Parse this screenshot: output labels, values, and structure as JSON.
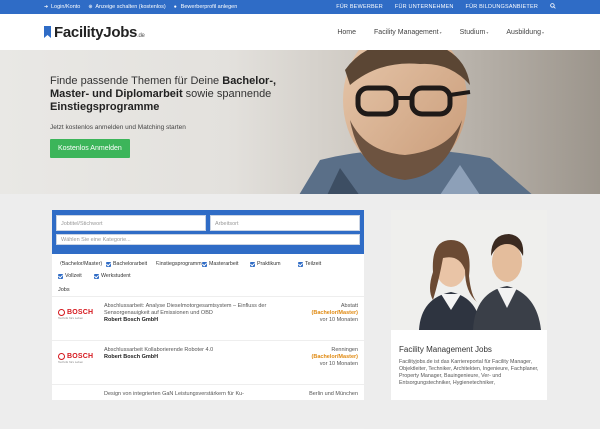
{
  "topbar": {
    "left": [
      {
        "icon": "login-icon",
        "label": "Login/Konto"
      },
      {
        "icon": "plus-icon",
        "label": "Anzeige schalten (kostenlos)"
      },
      {
        "icon": "user-icon",
        "label": "Bewerberprofil anlegen"
      }
    ],
    "right": [
      "FÜR BEWERBER",
      "FÜR UNTERNEHMEN",
      "FÜR BILDUNGSANBIETER"
    ],
    "search_icon": "search-icon"
  },
  "header": {
    "logo_text": "FacilityJobs",
    "logo_suffix": ".de",
    "nav": [
      "Home",
      "Facility Management",
      "Studium",
      "Ausbildung"
    ]
  },
  "hero": {
    "title_part1": "Finde passende Themen für Deine ",
    "title_bold1": "Bachelor-,",
    "title_bold2": "Master- und Diplomarbeit",
    "title_part2": " sowie spannende ",
    "title_bold3": "Einstiegsprogramme",
    "subtitle": "Jetzt kostenlos anmelden und Matching starten",
    "button": "Kostenlos Anmelden"
  },
  "search": {
    "query_placeholder": "Jobtitel/Stichwort",
    "location_placeholder": "Arbeitsort",
    "category_placeholder": "Wählen Sie eine Kategorie...",
    "filters": [
      "(Bachelor/Master)",
      "Bachelorarbeit",
      "Einstiegsprogramm",
      "Masterarbeit",
      "Praktikum",
      "Teilzeit",
      "Vollzeit",
      "Werkstudent"
    ],
    "jobs_label": "Jobs"
  },
  "jobs": [
    {
      "logo": "BOSCH",
      "logo_tag": "Technik fürs Leben",
      "title": "Abschlussarbeit: Analyse Dieselmotorgesamtsystem – Einfluss der Sensorgenauigkeit auf Emissionen und OBD",
      "company": "Robert Bosch GmbH",
      "location": "Abstatt",
      "type": "(Bachelor/Master)",
      "duration": "vor 10 Monaten"
    },
    {
      "logo": "BOSCH",
      "logo_tag": "Technik fürs Leben",
      "title": "Abschlussarbeit Kollaborierende Roboter 4.0",
      "company": "Robert Bosch GmbH",
      "location": "Renningen",
      "type": "(Bachelor/Master)",
      "duration": "vor 10 Monaten"
    },
    {
      "logo": "",
      "logo_tag": "",
      "title": "Design von integrierten GaN Leistungsverstärkern für Ku-",
      "company": "",
      "location": "Berlin und München",
      "type": "",
      "duration": ""
    }
  ],
  "side": {
    "title": "Facility Management Jobs",
    "text": "Facilityjobs.de ist das Karriereportal für Facility Manager, Objektleiter, Techniker, Architekten, Ingenieure, Fachplaner, Property Manager, Bauingenieure, Ver- und Entsorgungstechniker, Hygienetechniker,"
  },
  "colors": {
    "brand_blue": "#2f6cc6",
    "cta_green": "#3cb55a",
    "bosch_red": "#d5171d",
    "accent_orange": "#e08a12"
  }
}
